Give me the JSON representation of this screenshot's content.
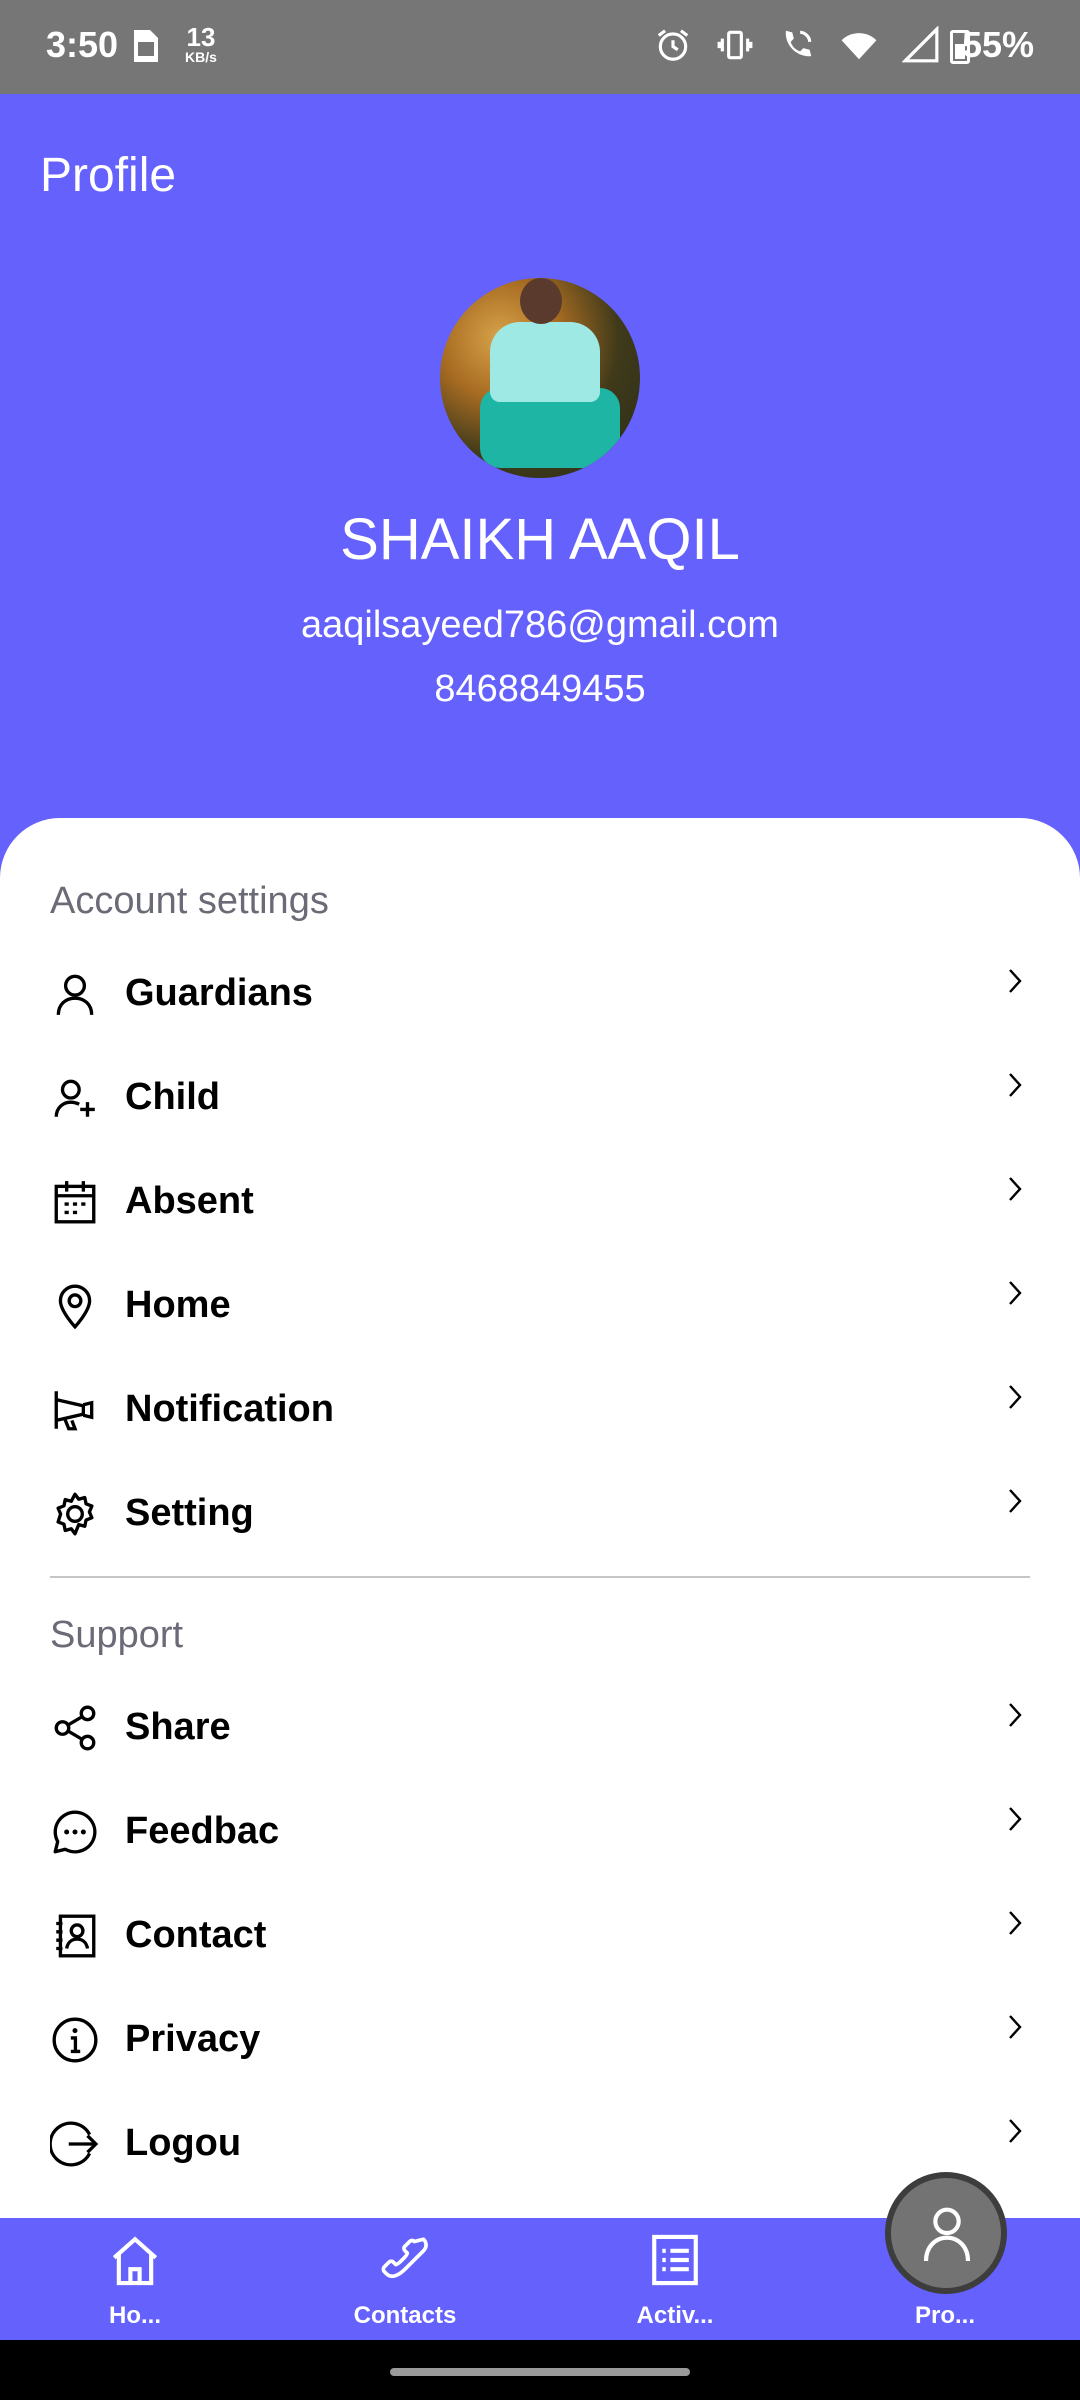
{
  "status_bar": {
    "time": "3:50",
    "speed_value": "13",
    "speed_unit": "KB/s",
    "battery": "55%",
    "icons": [
      "sim-icon",
      "alarm-icon",
      "vibrate-icon",
      "wifi-call-icon",
      "wifi-icon",
      "signal-icon",
      "battery-icon"
    ]
  },
  "header": {
    "title": "Profile",
    "name": "SHAIKH AAQIL",
    "email": "aaqilsayeed786@gmail.com",
    "phone": "8468849455"
  },
  "account_settings": {
    "title": "Account settings",
    "items": [
      {
        "label": "Guardians",
        "icon": "person-icon"
      },
      {
        "label": "Child",
        "icon": "person-add-icon"
      },
      {
        "label": "Absent",
        "icon": "calendar-icon"
      },
      {
        "label": "Home",
        "icon": "location-pin-icon"
      },
      {
        "label": "Notification",
        "icon": "megaphone-icon"
      },
      {
        "label": "Setting",
        "icon": "gear-icon"
      }
    ]
  },
  "support": {
    "title": "Support",
    "items": [
      {
        "label": "Share",
        "icon": "share-icon"
      },
      {
        "label": "Feedbac",
        "icon": "chat-bubble-icon"
      },
      {
        "label": "Contact",
        "icon": "contact-card-icon"
      },
      {
        "label": "Privacy",
        "icon": "info-icon"
      },
      {
        "label": "Logou",
        "icon": "logout-icon"
      }
    ]
  },
  "bottom_nav": {
    "items": [
      {
        "label": "Ho...",
        "icon": "home-icon"
      },
      {
        "label": "Contacts",
        "icon": "phone-icon"
      },
      {
        "label": "Activ...",
        "icon": "list-icon"
      },
      {
        "label": "Pro...",
        "icon": "profile-icon",
        "active": true
      }
    ]
  },
  "colors": {
    "primary": "#6461fc",
    "status_bar": "#767676",
    "section_title": "#6b6b78",
    "fab": "#737373"
  }
}
